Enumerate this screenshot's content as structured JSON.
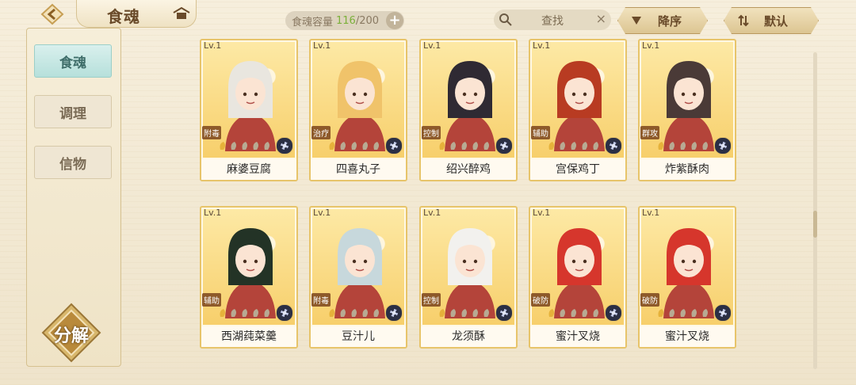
{
  "header": {
    "title": "食魂",
    "capacity_label": "食魂容量",
    "capacity_count": "116",
    "capacity_total": "/200",
    "capacity_add": "+",
    "search_placeholder": "查找",
    "search_clear": "×",
    "sort_label": "降序",
    "default_label": "默认"
  },
  "sidebar": {
    "items": [
      {
        "label": "食魂",
        "active": true
      },
      {
        "label": "调理",
        "active": false
      },
      {
        "label": "信物",
        "active": false
      }
    ],
    "decompose_label": "分解"
  },
  "cards": [
    {
      "level": "Lv.1",
      "role": "附毒",
      "name": "麻婆豆腐",
      "hair": "#e9e6df"
    },
    {
      "level": "Lv.1",
      "role": "治疗",
      "name": "四喜丸子",
      "hair": "#f0c36a"
    },
    {
      "level": "Lv.1",
      "role": "控制",
      "name": "绍兴醉鸡",
      "hair": "#2f2a33"
    },
    {
      "level": "Lv.1",
      "role": "辅助",
      "name": "宫保鸡丁",
      "hair": "#b83b22"
    },
    {
      "level": "Lv.1",
      "role": "群攻",
      "name": "炸紫酥肉",
      "hair": "#4a3a37"
    },
    {
      "level": "Lv.1",
      "role": "辅助",
      "name": "西湖莼菜羹",
      "hair": "#233326"
    },
    {
      "level": "Lv.1",
      "role": "附毒",
      "name": "豆汁儿",
      "hair": "#c7d8dc"
    },
    {
      "level": "Lv.1",
      "role": "控制",
      "name": "龙须酥",
      "hair": "#f2f1ee"
    },
    {
      "level": "Lv.1",
      "role": "破防",
      "name": "蜜汁叉烧",
      "hair": "#d6362c"
    },
    {
      "level": "Lv.1",
      "role": "破防",
      "name": "蜜汁叉烧",
      "hair": "#d6362c"
    }
  ],
  "colors": {
    "accent_active": "#b6e0db",
    "card_border": "#e7c46a",
    "capacity_count": "#7bb03a"
  }
}
